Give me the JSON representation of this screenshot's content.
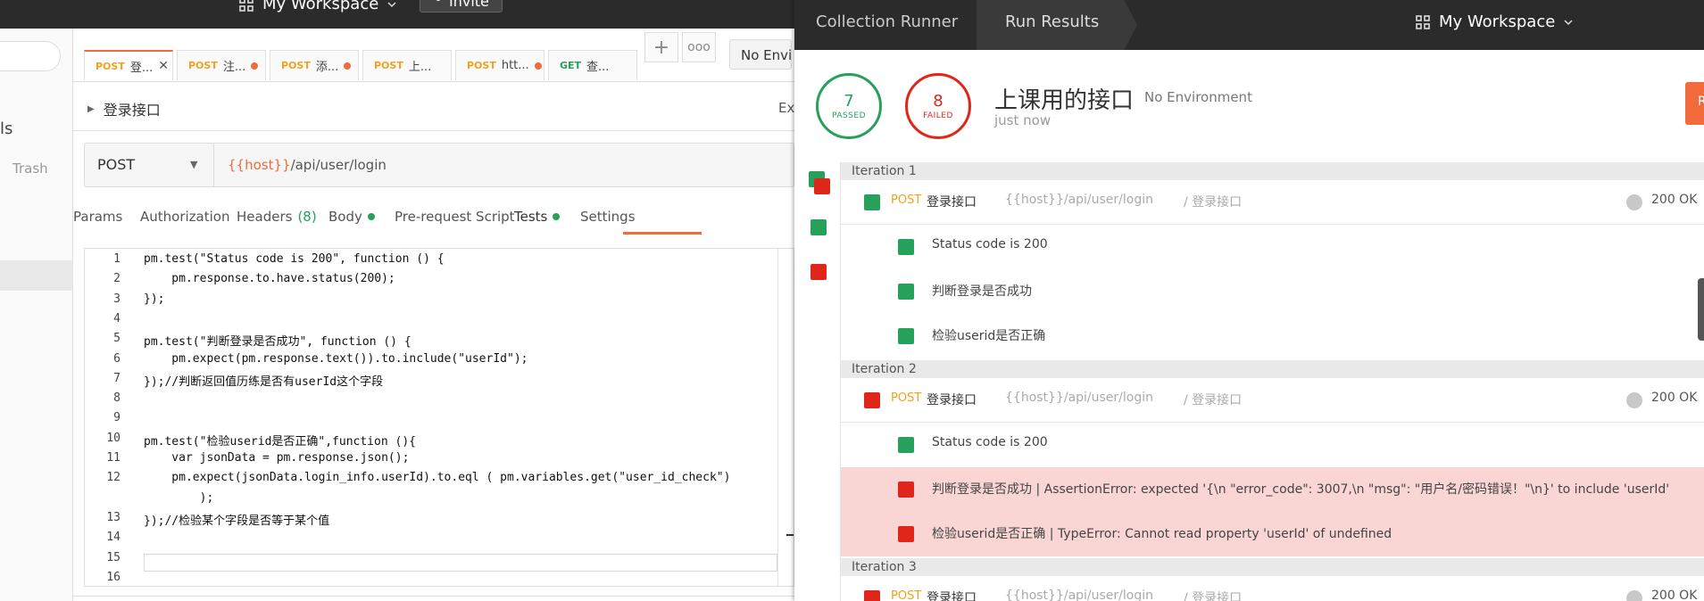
{
  "topbar": {
    "workspace": "My Workspace",
    "invite": "Invite"
  },
  "sidebar": {
    "frag": "ls",
    "trash": "Trash"
  },
  "tabs": [
    {
      "method": "POST",
      "name": "登...",
      "active": true,
      "close": "✕"
    },
    {
      "method": "POST",
      "name": "注...",
      "dot": true
    },
    {
      "method": "POST",
      "name": "添...",
      "dot": true
    },
    {
      "method": "POST",
      "name": "上..."
    },
    {
      "method": "POST",
      "name": "htt...",
      "dot": true
    },
    {
      "method": "GET",
      "name": "查..."
    }
  ],
  "tab_add": "+",
  "tab_more": "ooo",
  "env": "No Envi",
  "request": {
    "title": "登录接口",
    "ex_frag": "Ex",
    "method": "POST",
    "url_var": "{{host}}",
    "url_path": "/api/user/login"
  },
  "subtabs": {
    "params": "Params",
    "authorization": "Authorization",
    "headers": "Headers",
    "headers_count": "(8)",
    "body": "Body",
    "prerequest": "Pre-request Script",
    "tests": "Tests",
    "settings": "Settings"
  },
  "code": {
    "line_numbers": [
      "1",
      "2",
      "3",
      "4",
      "5",
      "6",
      "7",
      "8",
      "9",
      "10",
      "11",
      "12",
      "",
      "13",
      "14",
      "15",
      "16"
    ],
    "lines": [
      "pm.test(\"Status code is 200\", function () {",
      "    pm.response.to.have.status(200);",
      "});",
      "",
      "pm.test(\"判断登录是否成功\", function () {",
      "    pm.expect(pm.response.text()).to.include(\"userId\");",
      "});//判断返回值历练是否有userId这个字段",
      "",
      "",
      "pm.test(\"检验userid是否正确\",function (){",
      "    var jsonData = pm.response.json();",
      "    pm.expect(jsonData.login_info.userId).to.eql ( pm.variables.get(\"user_id_check\")",
      "        );",
      "});//检验某个字段是否等于某个值",
      "",
      "",
      ""
    ]
  },
  "runner": {
    "crumb1": "Collection Runner",
    "crumb2": "Run Results",
    "workspace": "My Workspace",
    "passed": "7",
    "passed_label": "PASSED",
    "failed": "8",
    "failed_label": "FAILED",
    "collection": "上课用的接口",
    "env": "No Environment",
    "time": "just now",
    "btn": "R",
    "iterations": [
      {
        "label": "Iteration 1",
        "status": "pass",
        "request": {
          "method": "POST",
          "name": "登录接口",
          "url": "{{host}}/api/user/login",
          "folder": "/ 登录接口",
          "code": "200 OK"
        },
        "tests": [
          {
            "text": "Status code is 200",
            "pass": true
          },
          {
            "text": "判断登录是否成功",
            "pass": true
          },
          {
            "text": "检验userid是否正确",
            "pass": true
          }
        ]
      },
      {
        "label": "Iteration 2",
        "status": "fail",
        "request": {
          "method": "POST",
          "name": "登录接口",
          "url": "{{host}}/api/user/login",
          "folder": "/ 登录接口",
          "code": "200 OK"
        },
        "tests": [
          {
            "text": "Status code is 200",
            "pass": true
          },
          {
            "text": "判断登录是否成功 | AssertionError: expected '{\\n \"error_code\": 3007,\\n \"msg\": \"用户名/密码错误！\"\\n}' to include 'userId'",
            "pass": false
          },
          {
            "text": "检验userid是否正确 | TypeError: Cannot read property 'userId' of undefined",
            "pass": false
          }
        ]
      },
      {
        "label": "Iteration 3",
        "status": "fail",
        "request": {
          "method": "POST",
          "name": "登录接口",
          "url": "{{host}}/api/user/login",
          "folder": "/ 登录接口",
          "code": "200 OK"
        }
      }
    ]
  },
  "colors": {
    "accent": "#f26b3a",
    "pass": "#26a05a",
    "fail": "#e0261b",
    "dark": "#2b2b2b"
  },
  "icons": [
    "grid-icon",
    "chevron-down-icon",
    "person-add-icon",
    "close-icon",
    "plus-icon",
    "more-icon",
    "caret-right-icon",
    "caret-down-icon"
  ]
}
